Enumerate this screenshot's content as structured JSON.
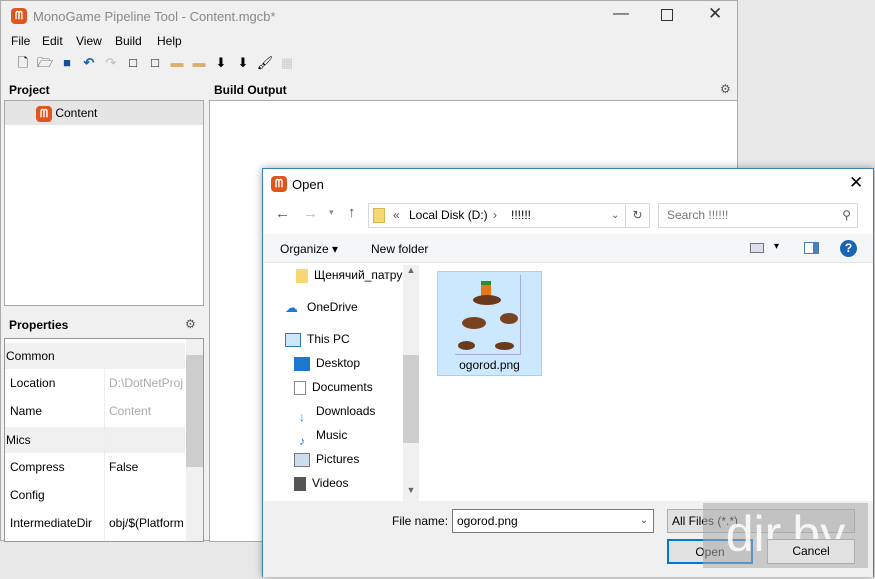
{
  "main": {
    "title": "MonoGame Pipeline Tool - Content.mgcb*",
    "menu": [
      "File",
      "Edit",
      "View",
      "Build",
      "Help"
    ],
    "toolbar_icons": [
      "new-icon",
      "open-icon",
      "save-icon",
      "undo-icon",
      "redo-icon",
      "new-item-icon",
      "add-item-icon",
      "new-folder-icon",
      "add-folder-icon",
      "build-icon",
      "rebuild-icon",
      "clean-icon",
      "cancel-build-icon"
    ],
    "project_label": "Project",
    "tree_root": "Content",
    "build_output_label": "Build Output",
    "properties_label": "Properties",
    "properties": {
      "cat1": "Common",
      "location_label": "Location",
      "location_value": "D:\\DotNetProj",
      "name_label": "Name",
      "name_value": "Content",
      "cat2": "Mics",
      "compress_label": "Compress",
      "compress_value": "False",
      "config_label": "Config",
      "config_value": "",
      "intdir_label": "IntermediateDir",
      "intdir_value": "obj/$(Platform"
    }
  },
  "dialog": {
    "title": "Open",
    "breadcrumb": [
      "«",
      "Local Disk (D:)",
      "›",
      "!!!!!!"
    ],
    "search_placeholder": "Search !!!!!!",
    "organize": "Organize ▾",
    "new_folder": "New folder",
    "nav": [
      "Щенячий_патру",
      "OneDrive",
      "This PC",
      "Desktop",
      "Documents",
      "Downloads",
      "Music",
      "Pictures",
      "Videos"
    ],
    "file": "ogorod.png",
    "file_name_label": "File name:",
    "file_name_value": "ogorod.png",
    "filter": "All Files (*.*)",
    "open": "Open",
    "cancel": "Cancel"
  },
  "watermark": "dir.by",
  "colors": {
    "accent": "#e0551e",
    "selection": "#cce8ff",
    "link": "#1a5fb4"
  }
}
